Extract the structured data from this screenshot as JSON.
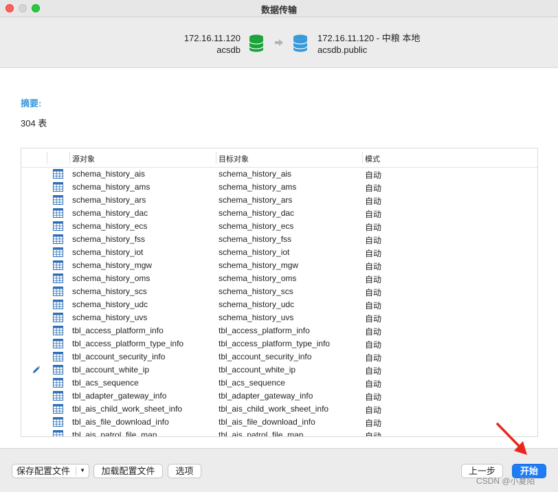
{
  "window": {
    "title": "数据传输"
  },
  "source": {
    "host": "172.16.11.120",
    "db": "acsdb"
  },
  "target": {
    "host": "172.16.11.120 - 中粮 本地",
    "db": "acsdb.public"
  },
  "summary": {
    "label": "摘要:",
    "value": "304 表"
  },
  "table": {
    "columns": [
      "源对象",
      "目标对象",
      "模式"
    ],
    "rows": [
      {
        "source": "schema_history_ais",
        "target": "schema_history_ais",
        "mode": "自动"
      },
      {
        "source": "schema_history_ams",
        "target": "schema_history_ams",
        "mode": "自动"
      },
      {
        "source": "schema_history_ars",
        "target": "schema_history_ars",
        "mode": "自动"
      },
      {
        "source": "schema_history_dac",
        "target": "schema_history_dac",
        "mode": "自动"
      },
      {
        "source": "schema_history_ecs",
        "target": "schema_history_ecs",
        "mode": "自动"
      },
      {
        "source": "schema_history_fss",
        "target": "schema_history_fss",
        "mode": "自动"
      },
      {
        "source": "schema_history_iot",
        "target": "schema_history_iot",
        "mode": "自动"
      },
      {
        "source": "schema_history_mgw",
        "target": "schema_history_mgw",
        "mode": "自动"
      },
      {
        "source": "schema_history_oms",
        "target": "schema_history_oms",
        "mode": "自动"
      },
      {
        "source": "schema_history_scs",
        "target": "schema_history_scs",
        "mode": "自动"
      },
      {
        "source": "schema_history_udc",
        "target": "schema_history_udc",
        "mode": "自动"
      },
      {
        "source": "schema_history_uvs",
        "target": "schema_history_uvs",
        "mode": "自动"
      },
      {
        "source": "tbl_access_platform_info",
        "target": "tbl_access_platform_info",
        "mode": "自动"
      },
      {
        "source": "tbl_access_platform_type_info",
        "target": "tbl_access_platform_type_info",
        "mode": "自动"
      },
      {
        "source": "tbl_account_security_info",
        "target": "tbl_account_security_info",
        "mode": "自动"
      },
      {
        "source": "tbl_account_white_ip",
        "target": "tbl_account_white_ip",
        "mode": "自动",
        "edited": true
      },
      {
        "source": "tbl_acs_sequence",
        "target": "tbl_acs_sequence",
        "mode": "自动"
      },
      {
        "source": "tbl_adapter_gateway_info",
        "target": "tbl_adapter_gateway_info",
        "mode": "自动"
      },
      {
        "source": "tbl_ais_child_work_sheet_info",
        "target": "tbl_ais_child_work_sheet_info",
        "mode": "自动"
      },
      {
        "source": "tbl_ais_file_download_info",
        "target": "tbl_ais_file_download_info",
        "mode": "自动"
      },
      {
        "source": "tbl_ais_patrol_file_map",
        "target": "tbl_ais_patrol_file_map",
        "mode": "自动"
      }
    ]
  },
  "footer": {
    "save_config": "保存配置文件",
    "load_config": "加载配置文件",
    "options": "选项",
    "prev": "上一步",
    "start": "开始",
    "watermark": "CSDN @小夏陌"
  },
  "colors": {
    "accent": "#1f7cf4",
    "source_db": "#1aa33a",
    "target_db": "#3a9ad9",
    "summary_label": "#3a9ad9",
    "annotation_arrow": "#e8261c"
  }
}
